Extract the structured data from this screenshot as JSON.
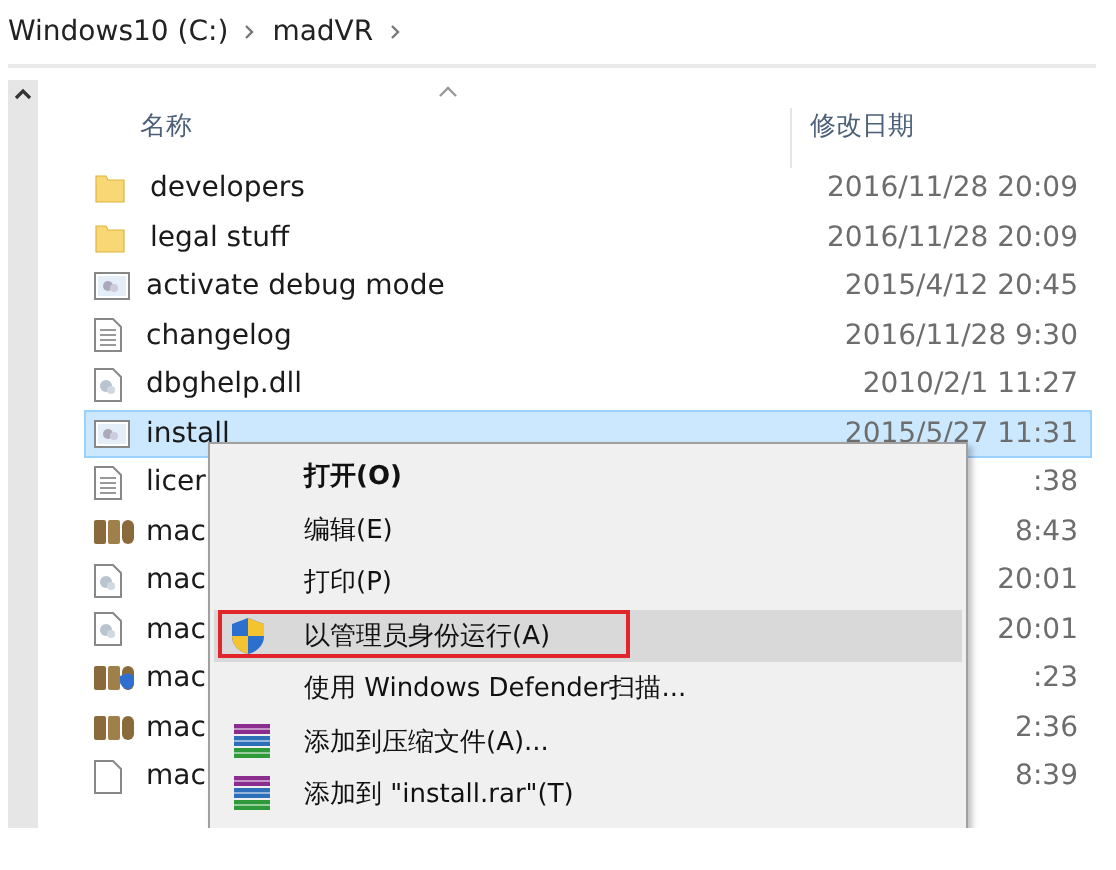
{
  "breadcrumb": [
    {
      "label": "Windows10 (C:)"
    },
    {
      "label": "madVR"
    }
  ],
  "columns": [
    {
      "label": "名称",
      "sorted": true
    },
    {
      "label": "修改日期",
      "sorted": false
    }
  ],
  "files": [
    {
      "name": "developers",
      "date": "2016/11/28 20:09",
      "kind": "folder",
      "selected": false
    },
    {
      "name": "legal stuff",
      "date": "2016/11/28 20:09",
      "kind": "folder",
      "selected": false
    },
    {
      "name": "activate debug mode",
      "date": "2015/4/12 20:45",
      "kind": "script",
      "selected": false
    },
    {
      "name": "changelog",
      "date": "2016/11/28 9:30",
      "kind": "text",
      "selected": false
    },
    {
      "name": "dbghelp.dll",
      "date": "2010/2/1 11:27",
      "kind": "dll",
      "selected": false
    },
    {
      "name": "install",
      "date": "2015/5/27 11:31",
      "kind": "script",
      "selected": true
    },
    {
      "name": "licer",
      "date": ":38",
      "kind": "text",
      "selected": false
    },
    {
      "name": "mac",
      "date": "8:43",
      "kind": "mad",
      "selected": false
    },
    {
      "name": "mac",
      "date": "20:01",
      "kind": "dll",
      "selected": false
    },
    {
      "name": "mac",
      "date": "20:01",
      "kind": "dll",
      "selected": false
    },
    {
      "name": "mac",
      "date": ":23",
      "kind": "madshield",
      "selected": false
    },
    {
      "name": "mac",
      "date": "2:36",
      "kind": "mad",
      "selected": false
    },
    {
      "name": "mac",
      "date": "8:39",
      "kind": "blank",
      "selected": false
    }
  ],
  "context_menu": {
    "items": [
      {
        "label": "打开(O)",
        "bold": true,
        "highlighted": false,
        "outlined": false,
        "kind": "plain"
      },
      {
        "label": "编辑(E)",
        "bold": false,
        "highlighted": false,
        "outlined": false,
        "kind": "plain"
      },
      {
        "label": "打印(P)",
        "bold": false,
        "highlighted": false,
        "outlined": false,
        "kind": "plain"
      },
      {
        "label": "以管理员身份运行(A)",
        "bold": false,
        "highlighted": true,
        "outlined": true,
        "kind": "shield"
      },
      {
        "label": "使用 Windows Defender扫描...",
        "bold": false,
        "highlighted": false,
        "outlined": false,
        "kind": "plain"
      },
      {
        "label": "添加到压缩文件(A)...",
        "bold": false,
        "highlighted": false,
        "outlined": false,
        "kind": "archive"
      },
      {
        "label": "添加到 \"install.rar\"(T)",
        "bold": false,
        "highlighted": false,
        "outlined": false,
        "kind": "archive"
      }
    ]
  }
}
